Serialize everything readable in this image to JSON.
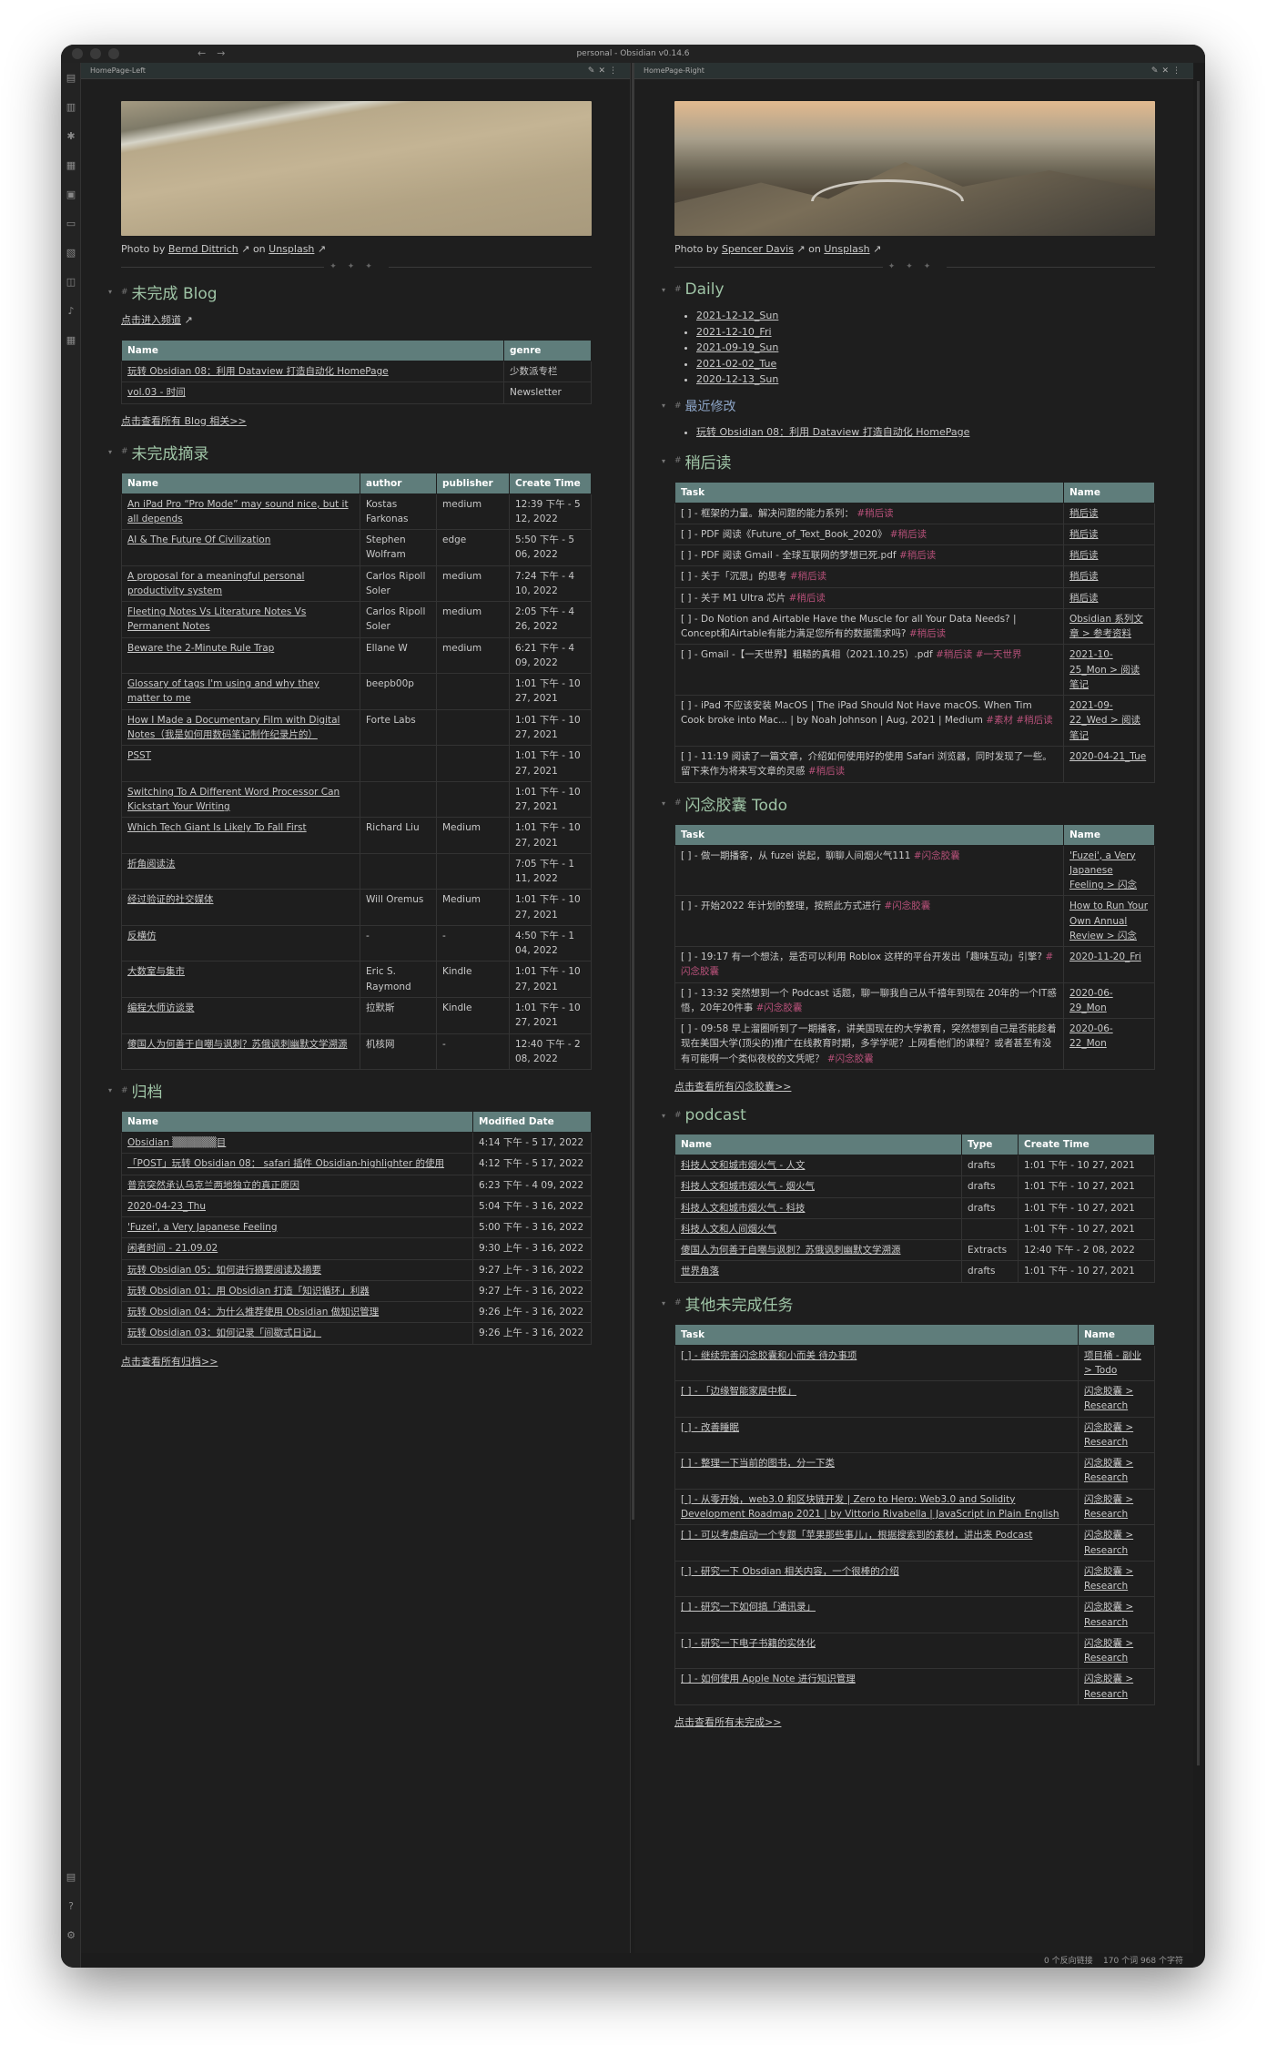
{
  "window": {
    "title": "personal - Obsidian v0.14.6"
  },
  "ribbon": {
    "icons": [
      "file-icon",
      "files-icon",
      "graph-icon",
      "calendar-icon",
      "gallery-icon",
      "template-icon",
      "archive-icon",
      "daily-icon",
      "mic-icon",
      "calendar-grid-icon"
    ],
    "bottom": [
      "vault-icon",
      "help-icon",
      "settings-icon"
    ]
  },
  "left": {
    "tab": "HomePage-Left",
    "credit": {
      "prefix": "Photo by",
      "author": "Bernd Dittrich",
      "on": "on",
      "site": "Unsplash"
    },
    "blog": {
      "heading": "未完成 Blog",
      "link": "点击进入频道",
      "headers": [
        "Name",
        "genre"
      ],
      "rows": [
        [
          "玩转 Obsidian 08：利用 Dataview 打造自动化 HomePage",
          "少数派专栏"
        ],
        [
          "vol.03 - 时间",
          "Newsletter"
        ]
      ],
      "more": "点击查看所有 Blog 相关>>"
    },
    "digest": {
      "heading": "未完成摘录",
      "headers": [
        "Name",
        "author",
        "publisher",
        "Create Time"
      ],
      "rows": [
        [
          "An iPad Pro “Pro Mode” may sound nice, but it all depends",
          "Kostas Farkonas",
          "medium",
          "12:39 下午 - 5 12, 2022"
        ],
        [
          "AI & The Future Of Civilization",
          "Stephen Wolfram",
          "edge",
          "5:50 下午 - 5 06, 2022"
        ],
        [
          "A proposal for a meaningful personal productivity system",
          "Carlos Ripoll Soler",
          "medium",
          "7:24 下午 - 4 10, 2022"
        ],
        [
          "Fleeting Notes Vs Literature Notes Vs Permanent Notes",
          "Carlos Ripoll Soler",
          "medium",
          "2:05 下午 - 4 26, 2022"
        ],
        [
          "Beware the 2-Minute Rule Trap",
          "Ellane W",
          "medium",
          "6:21 下午 - 4 09, 2022"
        ],
        [
          "Glossary of tags I'm using and why they matter to me",
          "beepb00p",
          "",
          "1:01 下午 - 10 27, 2021"
        ],
        [
          "How I Made a Documentary Film with Digital Notes（我是如何用数码笔记制作纪录片的）",
          "Forte Labs",
          "",
          "1:01 下午 - 10 27, 2021"
        ],
        [
          "PSST",
          "",
          "",
          "1:01 下午 - 10 27, 2021"
        ],
        [
          "Switching To A Different Word Processor Can Kickstart Your Writing",
          "",
          "",
          "1:01 下午 - 10 27, 2021"
        ],
        [
          "Which Tech Giant Is Likely To Fall First",
          "Richard Liu",
          "Medium",
          "1:01 下午 - 10 27, 2021"
        ],
        [
          "折角阅读法",
          "",
          "",
          "7:05 下午 - 1 11, 2022"
        ],
        [
          "经过验证的社交媒体",
          "Will Oremus",
          "Medium",
          "1:01 下午 - 10 27, 2021"
        ],
        [
          "反横仿",
          "-",
          "-",
          "4:50 下午 - 1 04, 2022"
        ],
        [
          "大数室与集市",
          "Eric S. Raymond",
          "Kindle",
          "1:01 下午 - 10 27, 2021"
        ],
        [
          "编程大师访谈录",
          "拉默斯",
          "Kindle",
          "1:01 下午 - 10 27, 2021"
        ],
        [
          "傻国人为何善于自嘲与讽刺？苏俄讽刺幽默文学溯源",
          "机核网",
          "-",
          "12:40 下午 - 2 08, 2022"
        ]
      ]
    },
    "archive": {
      "heading": "归档",
      "headers": [
        "Name",
        "Modified Date"
      ],
      "rows": [
        [
          "Obsidian ▒▒▒▒▒▒目",
          "4:14 下午 - 5 17, 2022"
        ],
        [
          "「POST」玩转 Obsidian 08： safari 插件 Obsidian-highlighter 的使用",
          "4:12 下午 - 5 17, 2022"
        ],
        [
          "普京突然承认乌克兰两地独立的真正原因",
          "6:23 下午 - 4 09, 2022"
        ],
        [
          "2020-04-23_Thu",
          "5:04 下午 - 3 16, 2022"
        ],
        [
          "'Fuzei', a Very Japanese Feeling",
          "5:00 下午 - 3 16, 2022"
        ],
        [
          "闲者时间 - 21.09.02",
          "9:30 上午 - 3 16, 2022"
        ],
        [
          "玩转 Obsidian 05：如何进行摘要阅读及摘要",
          "9:27 上午 - 3 16, 2022"
        ],
        [
          "玩转 Obsidian 01：用 Obsidian 打造「知识循环」利器",
          "9:27 上午 - 3 16, 2022"
        ],
        [
          "玩转 Obsidian 04：为什么推荐使用 Obsidian 做知识管理",
          "9:26 上午 - 3 16, 2022"
        ],
        [
          "玩转 Obsidian 03：如何记录「间歇式日记」",
          "9:26 上午 - 3 16, 2022"
        ]
      ],
      "more": "点击查看所有归档>>"
    }
  },
  "right": {
    "tab": "HomePage-Right",
    "credit": {
      "prefix": "Photo by",
      "author": "Spencer Davis",
      "on": "on",
      "site": "Unsplash"
    },
    "daily": {
      "heading": "Daily",
      "items": [
        "2021-12-12_Sun",
        "2021-12-10_Fri",
        "2021-09-19_Sun",
        "2021-02-02_Tue",
        "2020-12-13_Sun"
      ]
    },
    "recent": {
      "heading": "最近修改",
      "items": [
        "玩转 Obsidian 08：利用 Dataview 打造自动化 HomePage"
      ]
    },
    "later": {
      "heading": "稍后读",
      "headers": [
        "Task",
        "Name"
      ],
      "rows": [
        [
          "[ ] - 框架的力量。解决问题的能力系列：",
          "#稍后读",
          "稍后读"
        ],
        [
          "[ ] - PDF 阅读《Future_of_Text_Book_2020》",
          "#稍后读",
          "稍后读"
        ],
        [
          "[ ] - PDF 阅读 Gmail - 全球互联网的梦想已死.pdf",
          "#稍后读",
          "稍后读"
        ],
        [
          "[ ] - 关于「沉思」的思考",
          "#稍后读",
          "稍后读"
        ],
        [
          "[ ] - 关于 M1 Ultra 芯片",
          "#稍后读",
          "稍后读"
        ],
        [
          "[ ] - Do Notion and Airtable Have the Muscle for all Your Data Needs? | Concept和Airtable有能力满足您所有的数据需求吗?",
          "#稍后读",
          "Obsidian 系列文章 > 参考资料"
        ],
        [
          "[ ] - Gmail -【一天世界】粗糙的真相（2021.10.25）.pdf",
          "#稍后读 #一天世界",
          "2021-10-25_Mon > 阅读笔记"
        ],
        [
          "[ ] - iPad 不应该安装 MacOS | The iPad Should Not Have macOS. When Tim Cook broke into Mac... | by Noah Johnson | Aug, 2021 | Medium",
          "#素材 #稍后读",
          "2021-09-22_Wed > 阅读笔记"
        ],
        [
          "[ ] - 11:19 阅读了一篇文章，介绍如何使用好的使用 Safari 浏览器，同时发现了一些。留下来作为将来写文章的灵感",
          "#稍后读",
          "2020-04-21_Tue"
        ]
      ]
    },
    "flash": {
      "heading": "闪念胶囊 Todo",
      "headers": [
        "Task",
        "Name"
      ],
      "rows": [
        [
          "[ ] - 做一期播客，从 fuzei 说起，聊聊人间烟火气111",
          "#闪念胶囊",
          "'Fuzei', a Very Japanese Feeling > 闪念"
        ],
        [
          "[ ] - 开始2022 年计划的整理，按照此方式进行",
          "#闪念胶囊",
          "How to Run Your Own Annual Review > 闪念"
        ],
        [
          "[ ] - 19:17 有一个想法，是否可以利用 Roblox 这样的平台开发出「趣味互动」引擎?",
          "#闪念胶囊",
          "2020-11-20_Fri"
        ],
        [
          "[ ] - 13:32 突然想到一个 Podcast 话题，聊一聊我自己从千禧年到现在 20年的一个IT感悟，20年20件事",
          "#闪念胶囊",
          "2020-06-29_Mon"
        ],
        [
          "[ ] - 09:58 早上溜圈听到了一期播客，讲美国现在的大学教育，突然想到自己是否能趁着现在美国大学(顶尖的)推广在线教育时期，多学学呢？上网看他们的课程？或者甚至有没有可能啊一个类似夜校的文凭呢？",
          "#闪念胶囊",
          "2020-06-22_Mon"
        ]
      ],
      "more": "点击查看所有闪念胶囊>>"
    },
    "podcast": {
      "heading": "podcast",
      "headers": [
        "Name",
        "Type",
        "Create Time"
      ],
      "rows": [
        [
          "科技人文和城市烟火气 - 人文",
          "drafts",
          "1:01 下午 - 10 27, 2021"
        ],
        [
          "科技人文和城市烟火气 - 烟火气",
          "drafts",
          "1:01 下午 - 10 27, 2021"
        ],
        [
          "科技人文和城市烟火气 - 科技",
          "drafts",
          "1:01 下午 - 10 27, 2021"
        ],
        [
          "科技人文和人间烟火气",
          "",
          "1:01 下午 - 10 27, 2021"
        ],
        [
          "傻国人为何善于自嘲与讽刺？苏俄讽刺幽默文学溯源",
          "Extracts",
          "12:40 下午 - 2 08, 2022"
        ],
        [
          "世界角落",
          "drafts",
          "1:01 下午 - 10 27, 2021"
        ]
      ]
    },
    "other": {
      "heading": "其他未完成任务",
      "headers": [
        "Task",
        "Name"
      ],
      "rows": [
        [
          "[ ] - 继续完善闪念胶囊和小而美 待办事项",
          "项目桶 - 副业 > Todo"
        ],
        [
          "[ ] - 「边缘智能家居中枢」",
          "闪念胶囊 > Research"
        ],
        [
          "[ ] - 改善睡眠",
          "闪念胶囊 > Research"
        ],
        [
          "[ ] - 整理一下当前的图书，分一下类",
          "闪念胶囊 > Research"
        ],
        [
          "[ ] - 从零开始，web3.0 和区块链开发 | Zero to Hero: Web3.0 and Solidity Development Roadmap 2021 | by Vittorio Rivabella | JavaScript in Plain English",
          "闪念胶囊 > Research"
        ],
        [
          "[ ] - 可以考虑启动一个专题「苹果那些事儿」，根据搜索到的素材，讲出来 Podcast",
          "闪念胶囊 > Research"
        ],
        [
          "[ ] - 研究一下 Obsdian 相关内容，一个很棒的介绍",
          "闪念胶囊 > Research"
        ],
        [
          "[ ] - 研究一下如何搞「通讯录」",
          "闪念胶囊 > Research"
        ],
        [
          "[ ] - 研究一下电子书籍的实体化",
          "闪念胶囊 > Research"
        ],
        [
          "[ ] - 如何使用 Apple Note 进行知识管理",
          "闪念胶囊 > Research"
        ]
      ],
      "more": "点击查看所有未完成>>"
    }
  },
  "status": {
    "backlinks": "0 个反向链接",
    "count": "170 个词  968 个字符"
  }
}
